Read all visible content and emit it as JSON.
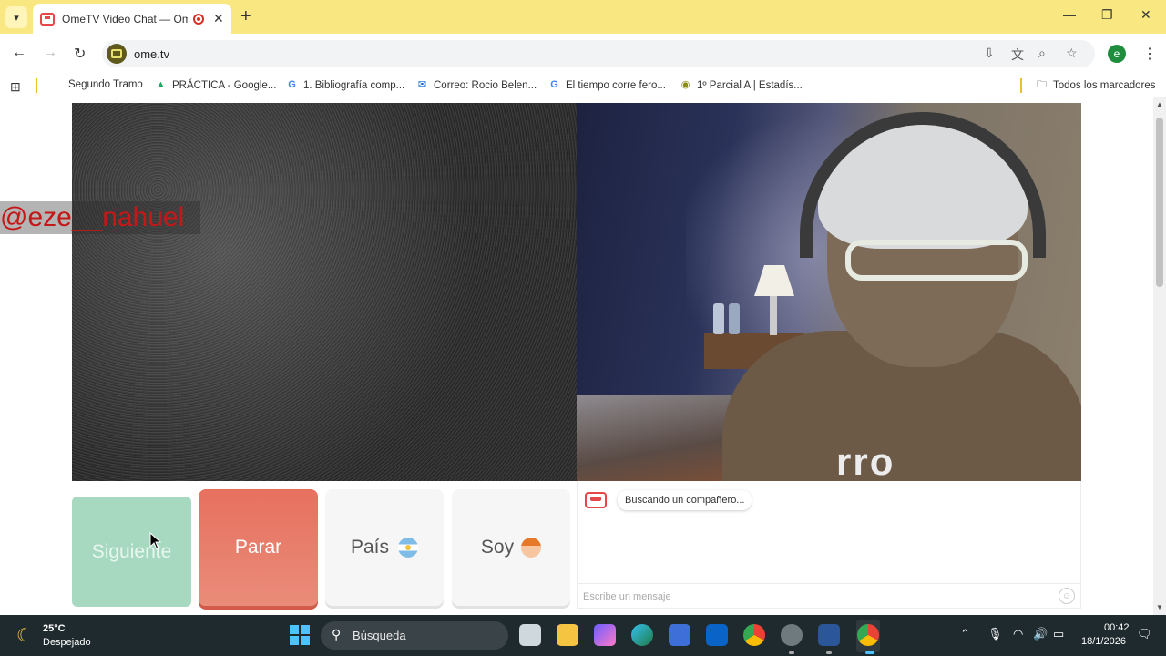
{
  "browser": {
    "tab_title": "OmeTV Video Chat — Ome",
    "tab_close": "✕",
    "new_tab": "+",
    "window_controls": {
      "minimize": "—",
      "restore": "❐",
      "close": "✕"
    },
    "url": "ome.tv",
    "profile_initial": "e",
    "bookmarks": [
      {
        "label": "Segundo Tramo",
        "icon": ""
      },
      {
        "label": "PRÁCTICA - Google...",
        "icon": "drive-icon"
      },
      {
        "label": "1. Bibliografía comp...",
        "icon": "google-icon"
      },
      {
        "label": "Correo: Rocio Belen...",
        "icon": "outlook-icon"
      },
      {
        "label": "El tiempo corre fero...",
        "icon": "google-icon"
      },
      {
        "label": "1º Parcial A | Estadís...",
        "icon": "moodle-icon"
      }
    ],
    "all_bookmarks": "Todos los marcadores"
  },
  "page": {
    "handle_overlay": "@eze__nahuel",
    "shirt_text": "rro",
    "buttons": {
      "next": "Siguiente",
      "stop": "Parar",
      "country": "País",
      "gender": "Soy"
    },
    "chat": {
      "status_message": "Buscando un compañero...",
      "input_placeholder": "Escribe un mensaje"
    }
  },
  "taskbar": {
    "weather_temp": "25°C",
    "weather_desc": "Despejado",
    "search_label": "Búsqueda",
    "clock_time": "00:42",
    "clock_date": "18/1/2026"
  },
  "colors": {
    "tabstrip": "#f9e882",
    "next_button": "#a6d9c0",
    "stop_button": "#e8705f",
    "handle_text": "#c41818",
    "taskbar": "#1f2a2e"
  }
}
